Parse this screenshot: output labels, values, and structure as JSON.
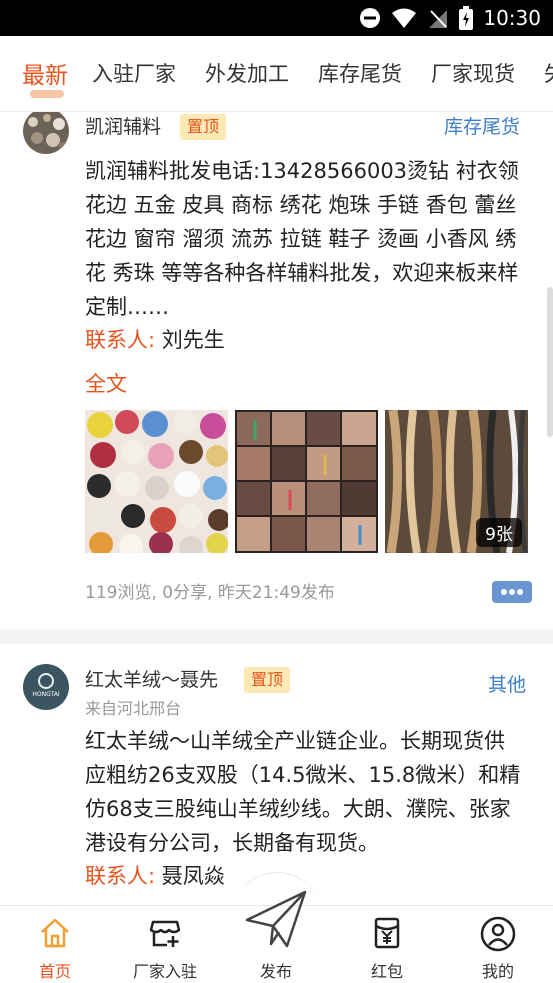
{
  "status_bar": {
    "time": "10:30"
  },
  "tabs": [
    {
      "label": "最新",
      "active": true
    },
    {
      "label": "入驻厂家",
      "active": false
    },
    {
      "label": "外发加工",
      "active": false
    },
    {
      "label": "库存尾货",
      "active": false
    },
    {
      "label": "厂家现货",
      "active": false
    },
    {
      "label": "失",
      "active": false
    }
  ],
  "posts": [
    {
      "author": "凯润辅料",
      "pin_label": "置顶",
      "category": "库存尾货",
      "body": "凯润辅料批发电话:13428566003烫钻 衬衣领 花边 五金 皮具 商标 绣花 炮珠 手链 香包 蕾丝花边 窗帘 溜须 流苏 拉链 鞋子 烫画 小香风 绣花 秀珠 等等各种各样辅料批发，欢迎来板来样定制……",
      "contact_label": "联系人:",
      "contact_name": "刘先生",
      "full_text_label": "全文",
      "image_count": "9张",
      "meta": "119浏览, 0分享, 昨天21:49发布"
    },
    {
      "author": "红太羊绒～聂先",
      "pin_label": "置顶",
      "category": "其他",
      "origin": "来自河北邢台",
      "avatar_text": "HONGTAI",
      "body": "红太羊绒～山羊绒全产业链企业。长期现货供应粗纺26支双股（14.5微米、15.8微米）和精仿68支三股纯山羊绒纱线。大朗、濮院、张家港设有分公司，长期备有现货。",
      "contact_label": "联系人:",
      "contact_name": "聂凤焱"
    }
  ],
  "bottom_nav": [
    {
      "label": "首页",
      "icon": "home-icon",
      "active": true
    },
    {
      "label": "厂家入驻",
      "icon": "store-add-icon",
      "active": false
    },
    {
      "label": "发布",
      "icon": "paper-plane-icon",
      "active": false
    },
    {
      "label": "红包",
      "icon": "red-packet-icon",
      "active": false
    },
    {
      "label": "我的",
      "icon": "user-icon",
      "active": false
    }
  ],
  "colors": {
    "accent": "#e8541e",
    "category_blue": "#3f7fc7",
    "pin_bg": "#fde9b5"
  }
}
